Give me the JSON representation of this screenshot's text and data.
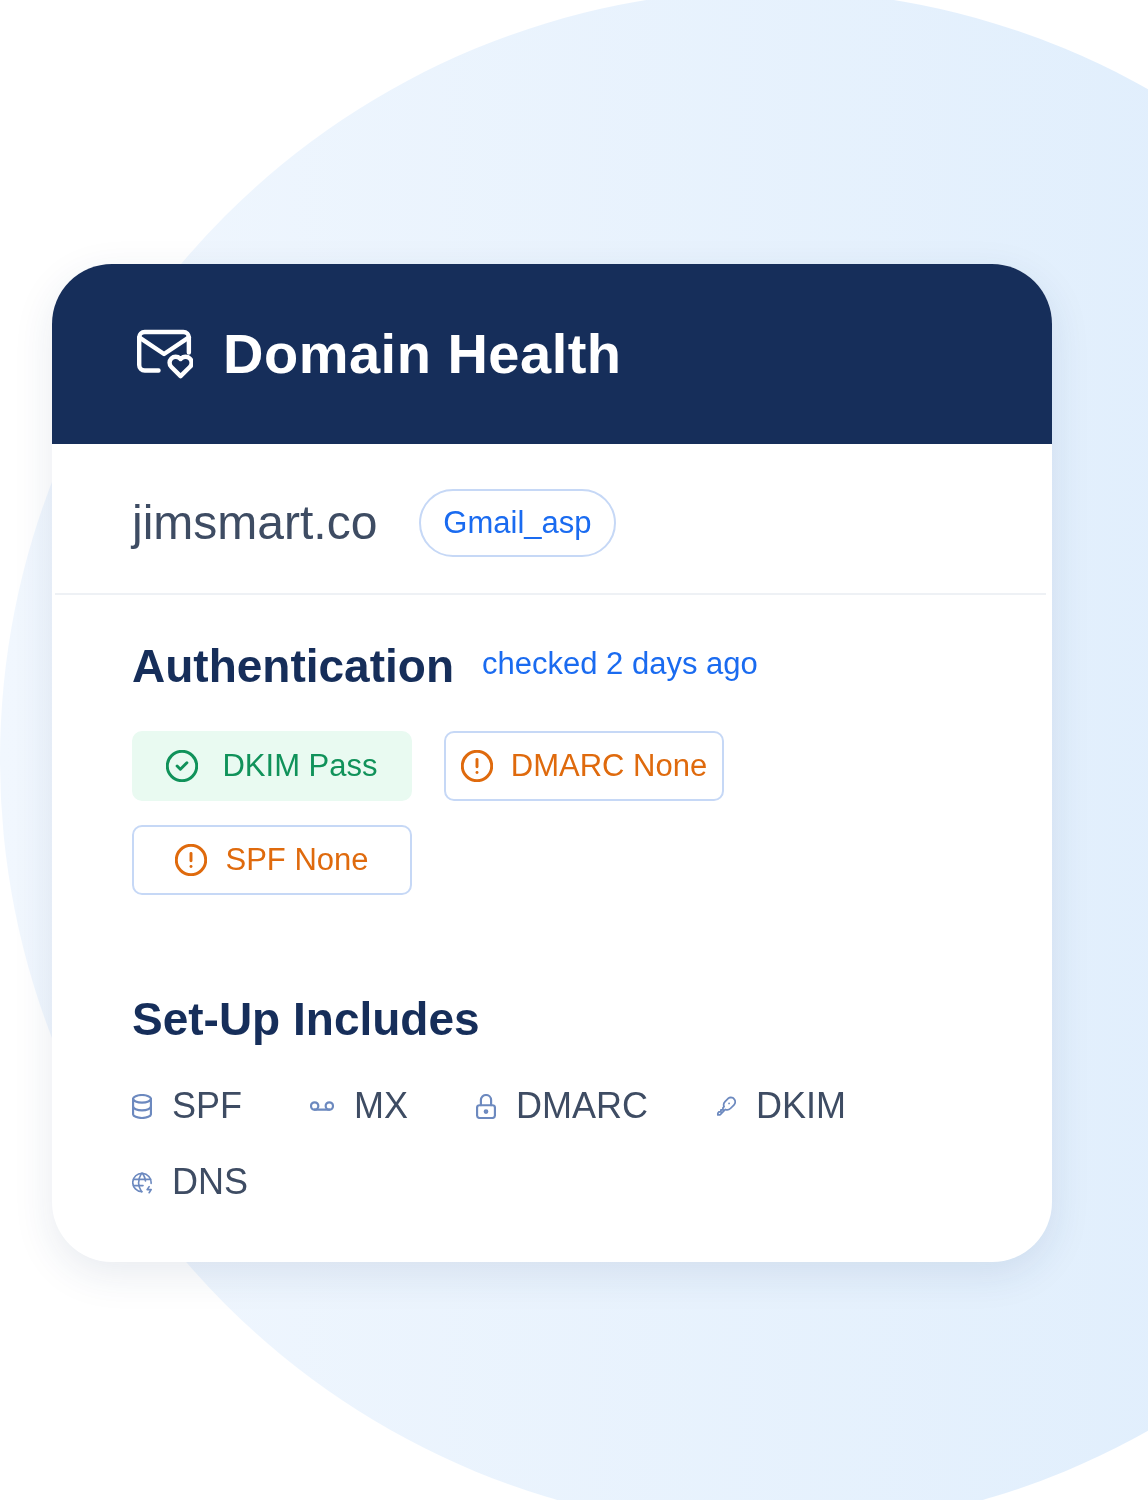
{
  "header": {
    "title": "Domain Health"
  },
  "domain": {
    "name": "jimsmart.co",
    "tag": "Gmail_asp"
  },
  "authentication": {
    "title": "Authentication",
    "checked": "checked 2 days ago",
    "results": [
      {
        "label": "DKIM Pass",
        "kind": "pass"
      },
      {
        "label": "DMARC None",
        "kind": "none"
      },
      {
        "label": "SPF None",
        "kind": "none"
      }
    ]
  },
  "setup": {
    "title": "Set-Up Includes",
    "items": [
      {
        "label": "SPF",
        "kind": "database"
      },
      {
        "label": "MX",
        "kind": "voicemail"
      },
      {
        "label": "DMARC",
        "kind": "lock"
      },
      {
        "label": "DKIM",
        "kind": "key"
      },
      {
        "label": "DNS",
        "kind": "globe"
      }
    ]
  }
}
